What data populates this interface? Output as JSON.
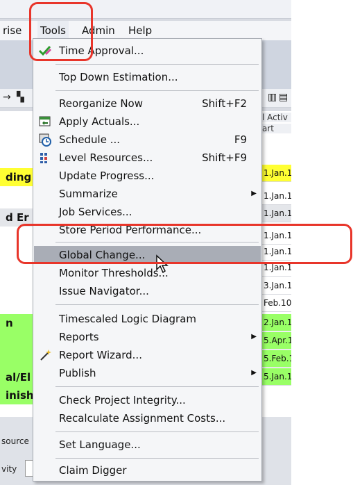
{
  "menubar": {
    "items": [
      {
        "label": "rise"
      },
      {
        "label": "Tools"
      },
      {
        "label": "Admin"
      },
      {
        "label": "Help"
      }
    ]
  },
  "background": {
    "left_cells": [
      "ding",
      "d Er",
      "n",
      "al/El",
      "inish"
    ],
    "bottom_labels": [
      "source",
      "vity"
    ],
    "right_header": [
      "l Activ",
      "art"
    ],
    "right_dates": [
      "1.Jan.1",
      "1.Jan.1",
      "1.Jan.1",
      "1.Jan.1",
      "1.Jan.1",
      "1.Jan.1",
      "3.Jan.1",
      "Feb.10",
      "2.Jan.1",
      "5.Apr.1",
      "5.Feb.1",
      "5.Jan.1"
    ]
  },
  "menu": {
    "items": [
      {
        "label": "Time Approval...",
        "shortcut": "",
        "icon": "check-pencil-icon"
      },
      {
        "label": "Top Down Estimation...",
        "shortcut": ""
      },
      {
        "label": "Reorganize Now",
        "shortcut": "Shift+F2"
      },
      {
        "label": "Apply Actuals...",
        "shortcut": "",
        "icon": "apply-actuals-icon"
      },
      {
        "label": "Schedule ...",
        "shortcut": "F9",
        "icon": "schedule-clock-icon"
      },
      {
        "label": "Level Resources...",
        "shortcut": "Shift+F9",
        "icon": "level-resources-icon"
      },
      {
        "label": "Update Progress...",
        "shortcut": ""
      },
      {
        "label": "Summarize",
        "shortcut": "",
        "submenu": true
      },
      {
        "label": "Job Services...",
        "shortcut": ""
      },
      {
        "label": "Store Period Performance...",
        "shortcut": ""
      },
      {
        "label": "Global Change...",
        "shortcut": "",
        "highlighted": true
      },
      {
        "label": "Monitor Thresholds...",
        "shortcut": ""
      },
      {
        "label": "Issue Navigator...",
        "shortcut": ""
      },
      {
        "label": "Timescaled Logic Diagram",
        "shortcut": ""
      },
      {
        "label": "Reports",
        "shortcut": "",
        "submenu": true
      },
      {
        "label": "Report Wizard...",
        "shortcut": "",
        "icon": "magic-wand-icon"
      },
      {
        "label": "Publish",
        "shortcut": "",
        "submenu": true
      },
      {
        "label": "Check Project Integrity...",
        "shortcut": ""
      },
      {
        "label": "Recalculate Assignment Costs...",
        "shortcut": ""
      },
      {
        "label": "Set Language...",
        "shortcut": ""
      },
      {
        "label": "Claim Digger",
        "shortcut": ""
      }
    ]
  },
  "colors": {
    "highlight": "#a9adb6",
    "annotation": "#e8352a",
    "yellow_row": "#ffff33",
    "green_row": "#99ff66"
  }
}
